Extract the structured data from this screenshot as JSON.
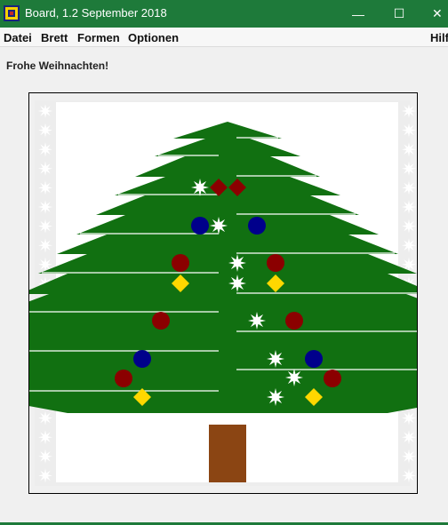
{
  "window": {
    "title": "Board, 1.2 September 2018",
    "icon": "board-app-icon",
    "controls": {
      "minimize": "—",
      "maximize": "☐",
      "close": "✕"
    },
    "accent_color": "#1e7a3a"
  },
  "menubar": {
    "items": [
      "Datei",
      "Brett",
      "Formen",
      "Optionen"
    ],
    "help": "Hilfe"
  },
  "greeting": "Frohe Weihnachten!",
  "board": {
    "background": "#ffffff",
    "border_pattern": "white-snowflake-stars-on-light-gray",
    "colors": {
      "tree": "#117011",
      "trunk": "#8b4513",
      "snow_lines": "#ffffff",
      "ornament_red": "#8b0000",
      "ornament_blue": "#00008b",
      "ornament_gold": "#ffd700",
      "star": "#ffffff"
    }
  }
}
